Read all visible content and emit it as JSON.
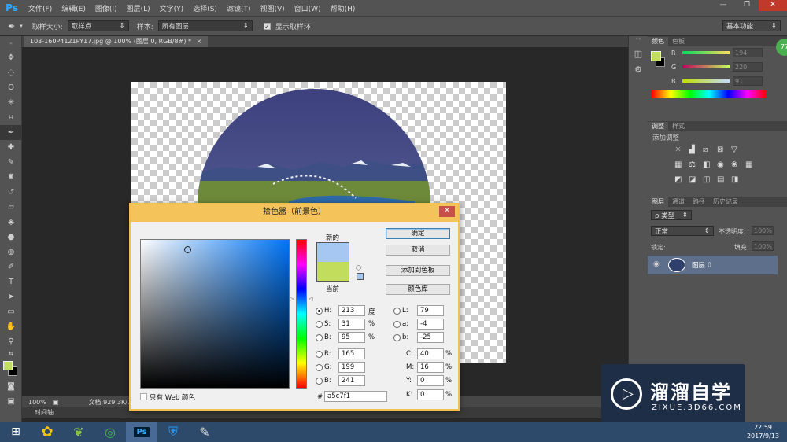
{
  "menubar": {
    "logo": "Ps",
    "items": [
      "文件(F)",
      "编辑(E)",
      "图像(I)",
      "图层(L)",
      "文字(Y)",
      "选择(S)",
      "滤镜(T)",
      "视图(V)",
      "窗口(W)",
      "帮助(H)"
    ],
    "min": "—",
    "max": "❐",
    "close": "✕"
  },
  "options": {
    "sample_size_label": "取样大小:",
    "sample_size_value": "取样点",
    "sample_label": "样本:",
    "sample_value": "所有图层",
    "show_ring_label": "显示取样环",
    "workspace": "基本功能"
  },
  "document": {
    "tab_title": "103-160P4121PY17.jpg @ 100% (图层 0, RGB/8#) *",
    "tab_close": "×",
    "zoom": "100%",
    "doc_info": "文档:929.3K/1",
    "timeline": "时间轴"
  },
  "color_panel": {
    "tabs": [
      "颜色",
      "色板"
    ],
    "channels": [
      {
        "label": "R",
        "value": "194"
      },
      {
        "label": "G",
        "value": "220"
      },
      {
        "label": "B",
        "value": "91"
      }
    ],
    "fg_color": "#c2dc5b",
    "bg_color": "#000000"
  },
  "adjust_panel": {
    "tabs": [
      "调整",
      "样式"
    ],
    "title": "添加调整"
  },
  "layers_panel": {
    "tabs": [
      "图层",
      "通道",
      "路径",
      "历史记录"
    ],
    "kind": "ρ 类型",
    "blend": "正常",
    "opacity_label": "不透明度:",
    "opacity": "100%",
    "lock_label": "锁定:",
    "fill_label": "填充:",
    "fill": "100%",
    "layer_name": "图层 0"
  },
  "badge": "77",
  "picker": {
    "title": "拾色器（前景色）",
    "close": "✕",
    "new_label": "新的",
    "current_label": "当前",
    "new_color": "#a5c7f1",
    "current_color": "#c2dc5b",
    "buttons": {
      "ok": "确定",
      "cancel": "取消",
      "add": "添加到色板",
      "library": "颜色库"
    },
    "hsb": [
      {
        "label": "H:",
        "value": "213",
        "unit": "度"
      },
      {
        "label": "S:",
        "value": "31",
        "unit": "%"
      },
      {
        "label": "B:",
        "value": "95",
        "unit": "%"
      }
    ],
    "rgb": [
      {
        "label": "R:",
        "value": "165"
      },
      {
        "label": "G:",
        "value": "199"
      },
      {
        "label": "B:",
        "value": "241"
      }
    ],
    "lab": [
      {
        "label": "L:",
        "value": "79"
      },
      {
        "label": "a:",
        "value": "-4"
      },
      {
        "label": "b:",
        "value": "-25"
      }
    ],
    "cmyk": [
      {
        "label": "C:",
        "value": "40",
        "unit": "%"
      },
      {
        "label": "M:",
        "value": "16",
        "unit": "%"
      },
      {
        "label": "Y:",
        "value": "0",
        "unit": "%"
      },
      {
        "label": "K:",
        "value": "0",
        "unit": "%"
      }
    ],
    "web_only": "只有 Web 颜色",
    "hash": "#",
    "hex": "a5c7f1"
  },
  "taskbar": {
    "time": "22:59",
    "date": "2017/9/13"
  },
  "watermark": {
    "brand": "溜溜自学",
    "url": "ZIXUE.3D66.COM"
  }
}
